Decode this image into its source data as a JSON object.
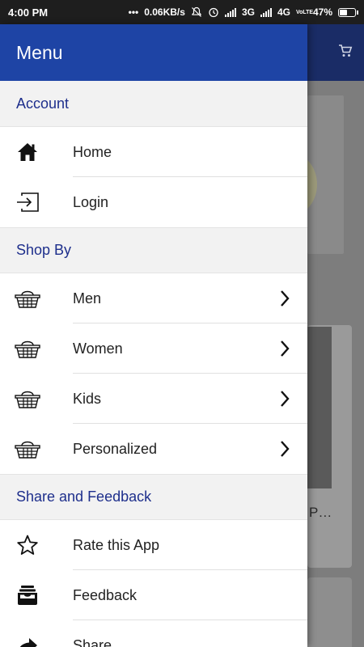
{
  "status_bar": {
    "time": "4:00 PM",
    "speed": "0.06KB/s",
    "net1": "3G",
    "net2": "4G",
    "volte": "VoLTE",
    "battery": "47%"
  },
  "drawer": {
    "title": "Menu",
    "sections": {
      "account": {
        "title": "Account",
        "items": [
          {
            "label": "Home",
            "icon": "home-icon"
          },
          {
            "label": "Login",
            "icon": "login-icon"
          }
        ]
      },
      "shop_by": {
        "title": "Shop By",
        "items": [
          {
            "label": "Men",
            "icon": "basket-icon"
          },
          {
            "label": "Women",
            "icon": "basket-icon"
          },
          {
            "label": "Kids",
            "icon": "basket-icon"
          },
          {
            "label": "Personalized",
            "icon": "basket-icon"
          }
        ]
      },
      "share_feedback": {
        "title": "Share and Feedback",
        "items": [
          {
            "label": "Rate this App",
            "icon": "star-icon"
          },
          {
            "label": "Feedback",
            "icon": "inbox-icon"
          },
          {
            "label": "Share",
            "icon": "share-icon"
          }
        ]
      }
    }
  },
  "background": {
    "truncated_text": "P…"
  },
  "colors": {
    "drawer_header": "#1e44a5",
    "section_text": "#1e2f8c",
    "section_bg": "#f2f2f2",
    "status_bar": "#1e1e1e"
  }
}
